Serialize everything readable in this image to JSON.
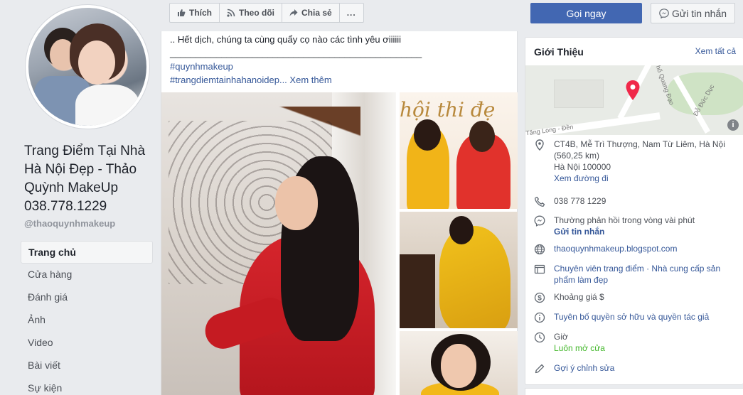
{
  "sidebar": {
    "page_name": "Trang Điểm Tại Nhà Hà Nội Đẹp - Thảo Quỳnh MakeUp 038.778.1229",
    "handle": "@thaoquynhmakeup",
    "items": [
      {
        "label": "Trang chủ",
        "active": true
      },
      {
        "label": "Cửa hàng"
      },
      {
        "label": "Đánh giá"
      },
      {
        "label": "Ảnh"
      },
      {
        "label": "Video"
      },
      {
        "label": "Bài viết"
      },
      {
        "label": "Sự kiện"
      }
    ]
  },
  "actions": {
    "like": "Thích",
    "follow": "Theo dõi",
    "share": "Chia sẻ",
    "more": "...",
    "call": "Gọi ngay",
    "message": "Gửi tin nhắn"
  },
  "post": {
    "line1": ".. Hết dịch, chúng ta cùng quẩy cọ nào các tình yêu ơiiiiii",
    "line2": "_________________________________________________",
    "hashtag1": "#quynhmakeup",
    "hashtag2": "#trangdiemtainhahanoidep...",
    "see_more": "Xem thêm",
    "photo_text": "hội thi đẹ"
  },
  "about": {
    "title": "Giới Thiệu",
    "see_all": "Xem tất cả",
    "map_labels": {
      "street_a": "Tăng Long - Đền",
      "street_b": "Phố Quang Đạo",
      "street_c": "Đỗ Đức Dục"
    },
    "address_line1": "CT4B, Mễ Trì Thượng, Nam Từ Liêm, Hà Nội",
    "address_line2": "(560,25 km)",
    "address_line3": "Hà Nội 100000",
    "directions": "Xem đường đi",
    "phone": "038 778 1229",
    "response": "Thường phản hồi trong vòng vài phút",
    "send_message": "Gửi tin nhắn",
    "website": "thaoquynhmakeup.blogspot.com",
    "category_line1": "Chuyên viên trang điểm · Nhà cung cấp sản",
    "category_line2": "phẩm làm đẹp",
    "price": "Khoảng giá $",
    "legal": "Tuyên bố quyền sở hữu và quyền tác giả",
    "hours_label": "Giờ",
    "hours_value": "Luôn mở cửa",
    "suggest_edit": "Gợi ý chỉnh sửa"
  },
  "colors": {
    "brand_blue": "#4267b2",
    "link": "#365899",
    "open_green": "#42b72a",
    "pin_red": "#f02849"
  }
}
